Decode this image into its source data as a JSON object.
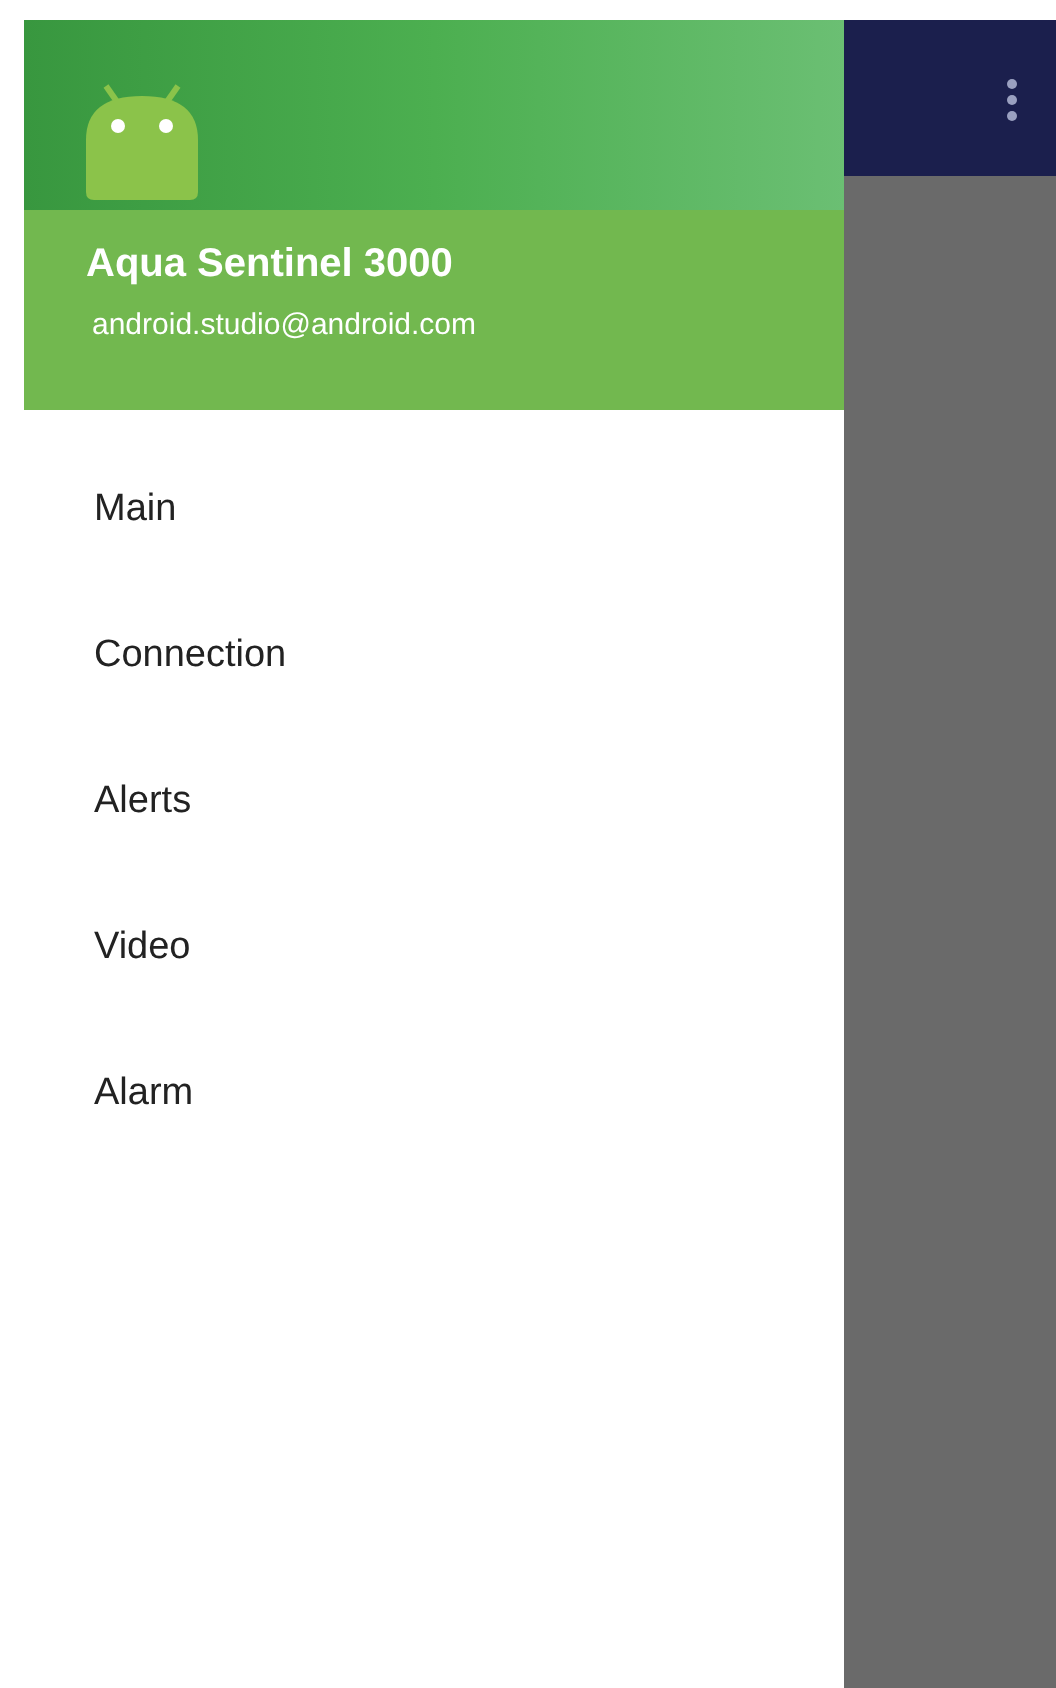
{
  "drawer": {
    "header": {
      "title": "Aqua Sentinel 3000",
      "email": "android.studio@android.com"
    },
    "items": [
      {
        "label": "Main"
      },
      {
        "label": "Connection"
      },
      {
        "label": "Alerts"
      },
      {
        "label": "Video"
      },
      {
        "label": "Alarm"
      }
    ]
  }
}
